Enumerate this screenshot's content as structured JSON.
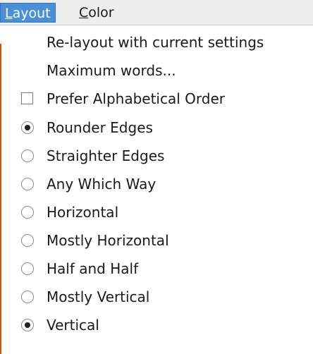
{
  "menubar": {
    "menus": [
      {
        "mnemonic": "L",
        "rest": "ayout",
        "active": true
      },
      {
        "mnemonic": "C",
        "rest": "olor",
        "active": false
      }
    ]
  },
  "layout_menu": {
    "items": [
      {
        "label": "Re-layout with current settings",
        "kind": "action"
      },
      {
        "label": "Maximum words...",
        "kind": "action"
      },
      {
        "label": "Prefer Alphabetical Order",
        "kind": "check",
        "checked": false
      },
      {
        "label": "Rounder Edges",
        "kind": "radio",
        "checked": true
      },
      {
        "label": "Straighter Edges",
        "kind": "radio",
        "checked": false
      },
      {
        "label": "Any Which Way",
        "kind": "radio",
        "checked": false
      },
      {
        "label": "Horizontal",
        "kind": "radio",
        "checked": false
      },
      {
        "label": "Mostly Horizontal",
        "kind": "radio",
        "checked": false
      },
      {
        "label": "Half and Half",
        "kind": "radio",
        "checked": false
      },
      {
        "label": "Mostly Vertical",
        "kind": "radio",
        "checked": false
      },
      {
        "label": "Vertical",
        "kind": "radio",
        "checked": true
      }
    ]
  },
  "colors": {
    "menu_highlight": "#4a90d9",
    "window_edge": "#c45a12"
  }
}
